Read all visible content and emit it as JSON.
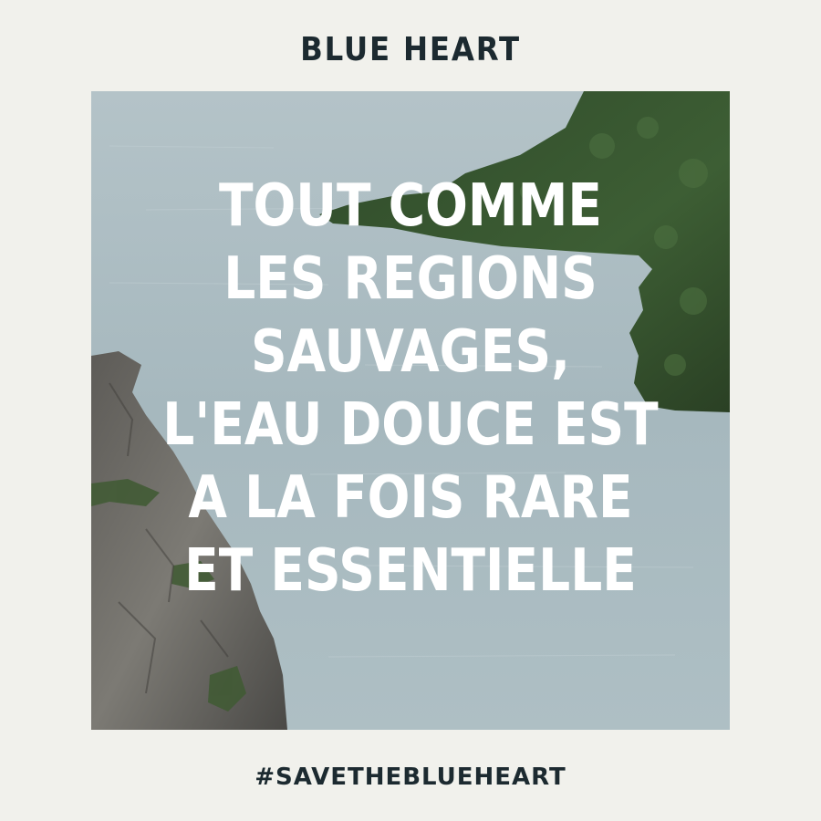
{
  "header": {
    "brand": "BLUE HEART"
  },
  "main": {
    "quote_lines": [
      "TOUT COMME",
      "LES REGIONS",
      "SAUVAGES,",
      "L'EAU DOUCE EST",
      "A LA FOIS RARE",
      "ET ESSENTIELLE"
    ]
  },
  "footer": {
    "hashtag": "#SAVETHEBLUEHEART"
  },
  "colors": {
    "background": "#f1f1ec",
    "brand_text": "#1c2a30",
    "water": "#a7b9c0",
    "forest": "#3b5a32",
    "rock": "#6f6c66",
    "quote_text": "#ffffff"
  }
}
